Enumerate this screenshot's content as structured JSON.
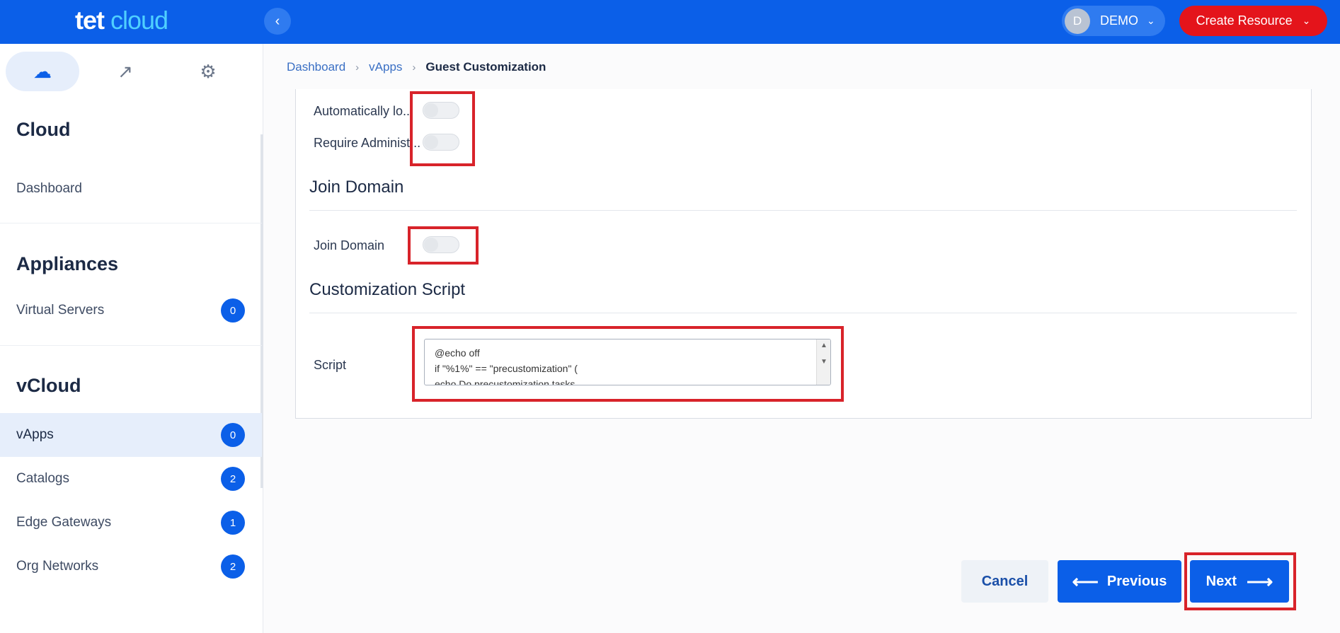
{
  "app": {
    "logo_part1": "tet",
    "logo_part2": "cloud"
  },
  "topbar": {
    "collapse_icon": "‹",
    "user_initial": "D",
    "user_name": "DEMO",
    "user_chevron": "⌄",
    "create_label": "Create Resource",
    "create_chevron": "⌄"
  },
  "sidebar": {
    "tabs": [
      {
        "icon": "cloud-icon",
        "glyph": "☁",
        "active": true
      },
      {
        "icon": "trending-icon",
        "glyph": "↗",
        "active": false
      },
      {
        "icon": "gear-icon",
        "glyph": "⚙",
        "active": false
      }
    ],
    "sections": [
      {
        "title": "Cloud",
        "items": [
          {
            "label": "Dashboard",
            "count": ""
          }
        ]
      },
      {
        "title": "Appliances",
        "items": [
          {
            "label": "Virtual Servers",
            "count": "0"
          }
        ]
      },
      {
        "title": "vCloud",
        "items": [
          {
            "label": "vApps",
            "count": "0",
            "active": true
          },
          {
            "label": "Catalogs",
            "count": "2"
          },
          {
            "label": "Edge Gateways",
            "count": "1"
          },
          {
            "label": "Org Networks",
            "count": "2"
          }
        ]
      }
    ]
  },
  "breadcrumb": {
    "items": [
      "Dashboard",
      "vApps"
    ],
    "separator": "›",
    "current": "Guest Customization"
  },
  "form": {
    "auto_logon_label": "Automatically lo...",
    "require_admin_label": "Require Administ...",
    "join_domain_heading": "Join Domain",
    "join_domain_label": "Join Domain",
    "script_heading": "Customization Script",
    "script_label": "Script",
    "script_lines": [
      "@echo off",
      "if \"%1%\" == \"precustomization\" (",
      "echo Do precustomization tasks"
    ],
    "toggles": {
      "auto_logon": false,
      "require_admin": false,
      "join_domain": false
    }
  },
  "footer": {
    "cancel_label": "Cancel",
    "previous_label": "Previous",
    "next_label": "Next",
    "prev_arrow": "⟵",
    "next_arrow": "⟶"
  },
  "colors": {
    "primary": "#0b5fe8",
    "danger": "#e4141b",
    "highlight": "#d8232a"
  }
}
